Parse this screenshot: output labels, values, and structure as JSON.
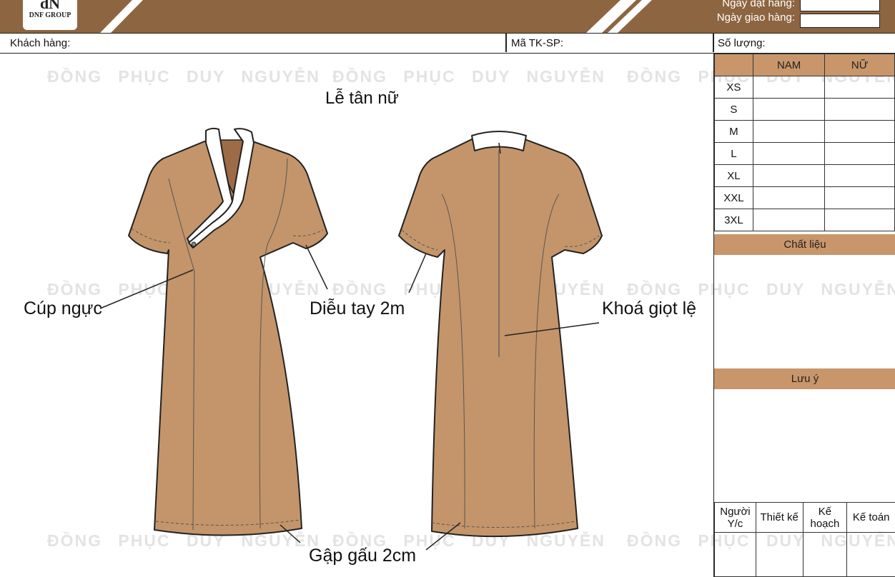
{
  "header": {
    "logo_text": "DNF GROUP",
    "order_date_label": "Ngày đặt hàng:",
    "delivery_date_label": "Ngày giao hàng:",
    "order_date_value": "",
    "delivery_date_value": ""
  },
  "info": {
    "customer_label": "Khách hàng:",
    "product_code_label": "Mã TK-SP:",
    "quantity_label": "Số lượng:"
  },
  "size_table": {
    "headers": [
      "",
      "NAM",
      "NỮ"
    ],
    "rows": [
      "XS",
      "S",
      "M",
      "L",
      "XL",
      "XXL",
      "3XL"
    ]
  },
  "material_label": "Chất liệu",
  "note_label": "Lưu ý",
  "signatures": [
    "Người Y/c",
    "Thiết kế",
    "Kế hoạch",
    "Kế toán"
  ],
  "design": {
    "title": "Lễ tân nữ",
    "callouts": {
      "bust_darts": "Cúp ngực",
      "sleeve_topstitch": "Diễu tay 2m",
      "teardrop_zipper": "Khoá giọt lệ",
      "hem_fold": "Gập gấu 2cm"
    }
  },
  "watermark": "ĐỒNG PHỤC DUY NGUYỄN",
  "colors": {
    "header_brown": "#8d6540",
    "garment_tan": "#c4956a",
    "table_header": "#c8966a"
  }
}
